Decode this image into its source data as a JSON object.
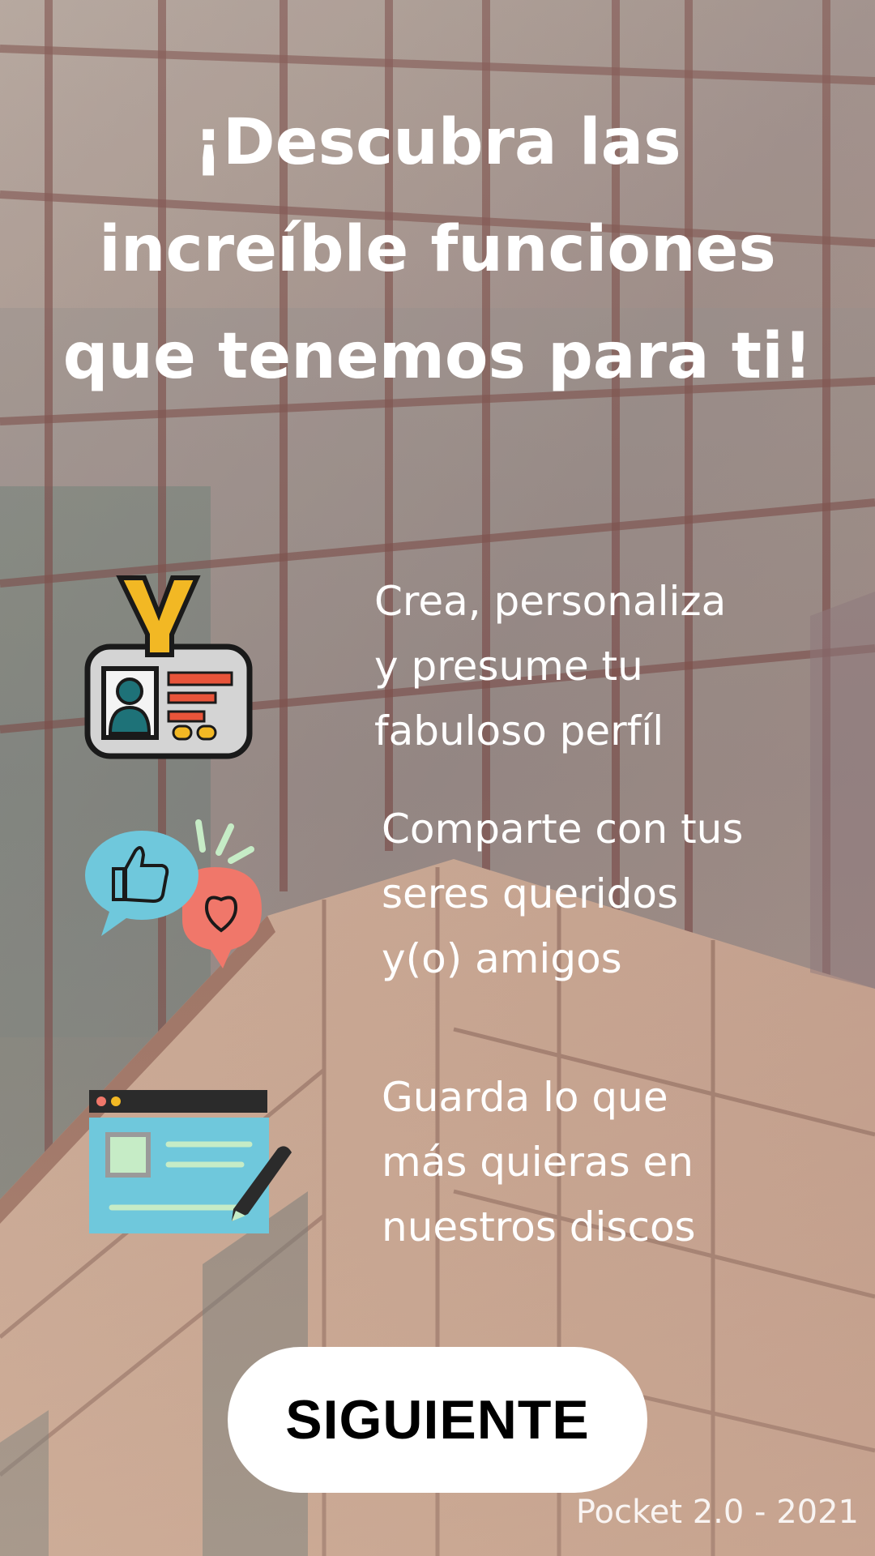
{
  "title_lines": [
    "¡Descubra las",
    "increíble funciones",
    "que tenemos para ti!"
  ],
  "features": [
    {
      "icon": "id-badge-icon",
      "lines": [
        "Crea, personaliza",
        "y presume tu",
        "fabuloso perfíl"
      ]
    },
    {
      "icon": "like-heart-chat-icon",
      "lines": [
        "Comparte con tus",
        "seres queridos",
        "y(o) amigos"
      ]
    },
    {
      "icon": "browser-window-pencil-icon",
      "lines": [
        "Guarda lo que",
        "más quieras en",
        "nuestros discos"
      ]
    }
  ],
  "next_button_label": "SIGUIENTE",
  "footer_text": "Pocket 2.0 - 2021",
  "colors": {
    "text": "#ffffff",
    "button_bg": "#ffffff",
    "button_text": "#000000",
    "icon_teal": "#1e7278",
    "icon_yellow": "#f2b824",
    "icon_red": "#e8543a",
    "icon_light_blue": "#6fc8dc",
    "icon_coral": "#f0776a",
    "icon_mint": "#c6ecc6"
  }
}
